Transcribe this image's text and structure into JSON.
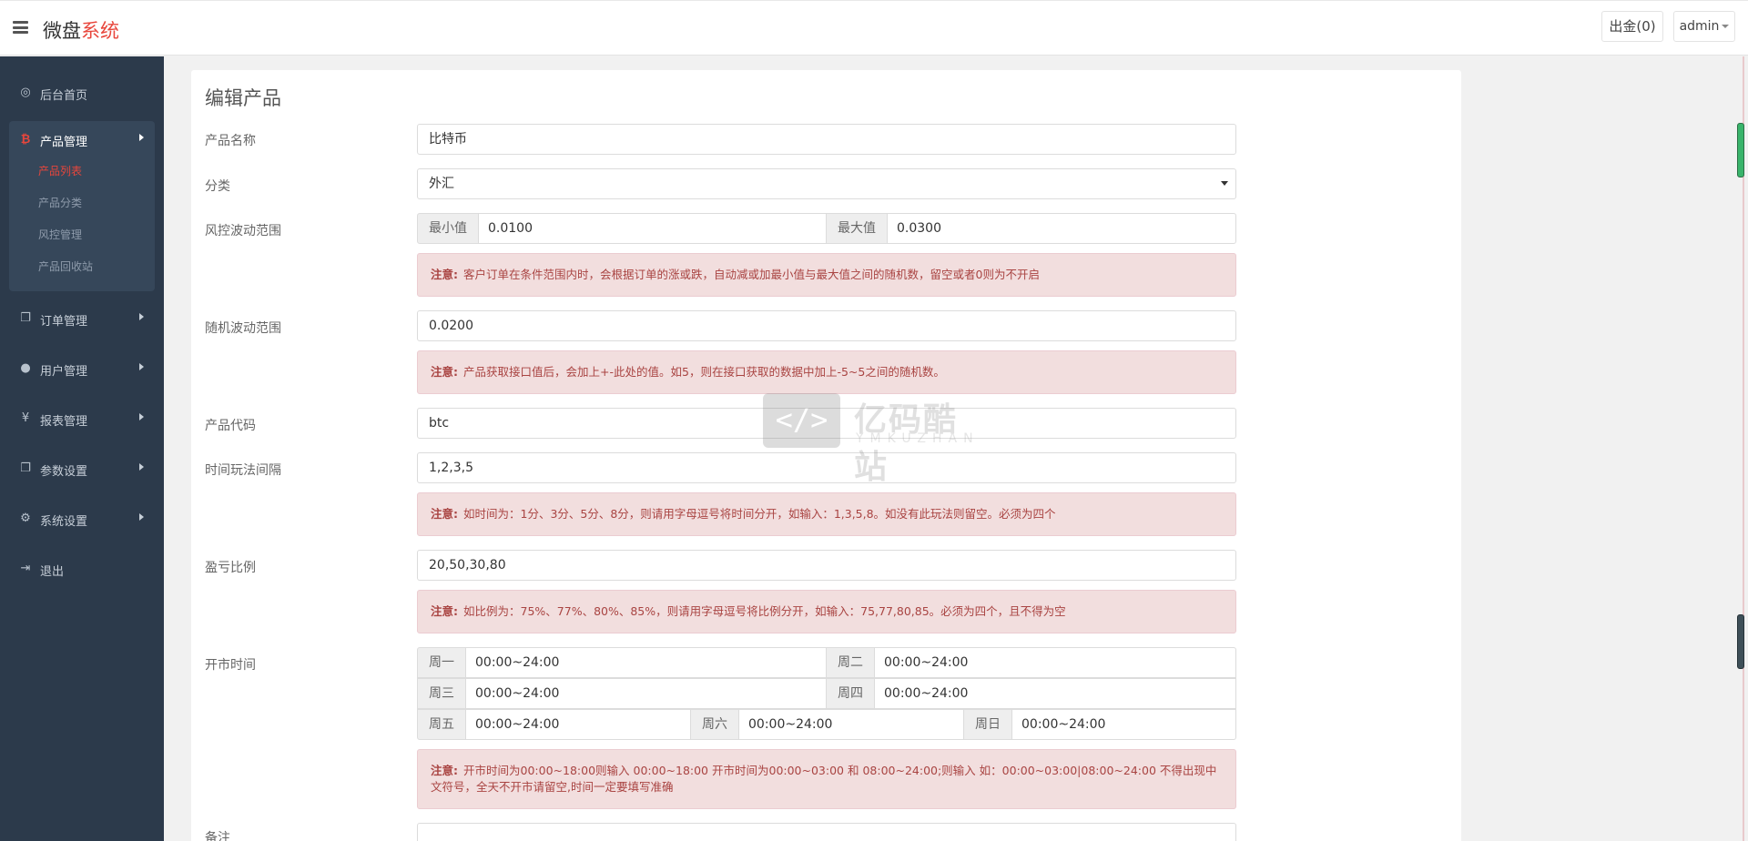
{
  "brand": {
    "main": "微盘",
    "accent": "系统"
  },
  "header": {
    "withdraw_label": "出金(0)",
    "user_label": "admin"
  },
  "sidebar": {
    "items": [
      {
        "label": "后台首页",
        "icon": "dashboard-icon"
      },
      {
        "label": "产品管理",
        "icon": "bitcoin-icon"
      },
      {
        "label": "订单管理",
        "icon": "copy-icon"
      },
      {
        "label": "用户管理",
        "icon": "user-icon"
      },
      {
        "label": "报表管理",
        "icon": "yen-icon"
      },
      {
        "label": "参数设置",
        "icon": "copy-icon"
      },
      {
        "label": "系统设置",
        "icon": "gears-icon"
      },
      {
        "label": "退出",
        "icon": "sign-out-icon"
      }
    ],
    "product_sub": [
      "产品列表",
      "产品分类",
      "风控管理",
      "产品回收站"
    ]
  },
  "form": {
    "title": "编辑产品",
    "name": {
      "label": "产品名称",
      "value": "比特币"
    },
    "category": {
      "label": "分类",
      "value": "外汇"
    },
    "risk": {
      "label": "风控波动范围",
      "min_label": "最小值",
      "min_value": "0.0100",
      "max_label": "最大值",
      "max_value": "0.0300",
      "note_prefix": "注意:",
      "note": "客户订单在条件范围内时，会根据订单的涨或跌，自动减或加最小值与最大值之间的随机数，留空或者0则为不开启"
    },
    "random": {
      "label": "随机波动范围",
      "value": "0.0200",
      "note_prefix": "注意:",
      "note": "产品获取接口值后，会加上+-此处的值。如5，则在接口获取的数据中加上-5~5之间的随机数。"
    },
    "code": {
      "label": "产品代码",
      "value": "btc"
    },
    "interval": {
      "label": "时间玩法间隔",
      "value": "1,2,3,5",
      "note_prefix": "注意:",
      "note": "如时间为：1分、3分、5分、8分，则请用字母逗号将时间分开，如输入：1,3,5,8。如没有此玩法则留空。必须为四个"
    },
    "ratio": {
      "label": "盈亏比例",
      "value": "20,50,30,80",
      "note_prefix": "注意:",
      "note": "如比例为：75%、77%、80%、85%，则请用字母逗号将比例分开，如输入：75,77,80,85。必须为四个，且不得为空"
    },
    "open_time": {
      "label": "开市时间",
      "days": [
        {
          "day": "周一",
          "value": "00:00~24:00"
        },
        {
          "day": "周二",
          "value": "00:00~24:00"
        },
        {
          "day": "周三",
          "value": "00:00~24:00"
        },
        {
          "day": "周四",
          "value": "00:00~24:00"
        },
        {
          "day": "周五",
          "value": "00:00~24:00"
        },
        {
          "day": "周六",
          "value": "00:00~24:00"
        },
        {
          "day": "周日",
          "value": "00:00~24:00"
        }
      ],
      "note_prefix": "注意:",
      "note": "开市时间为00:00~18:00则输入 00:00~18:00 开市时间为00:00~03:00 和 08:00~24:00;则输入 如：00:00~03:00|08:00~24:00 不得出现中文符号，全天不开市请留空,时间一定要填写准确"
    },
    "remark": {
      "label": "备注"
    }
  },
  "watermark": {
    "glyph": "</>",
    "main": "亿码酷站",
    "sub": "YMKUZHAN"
  }
}
